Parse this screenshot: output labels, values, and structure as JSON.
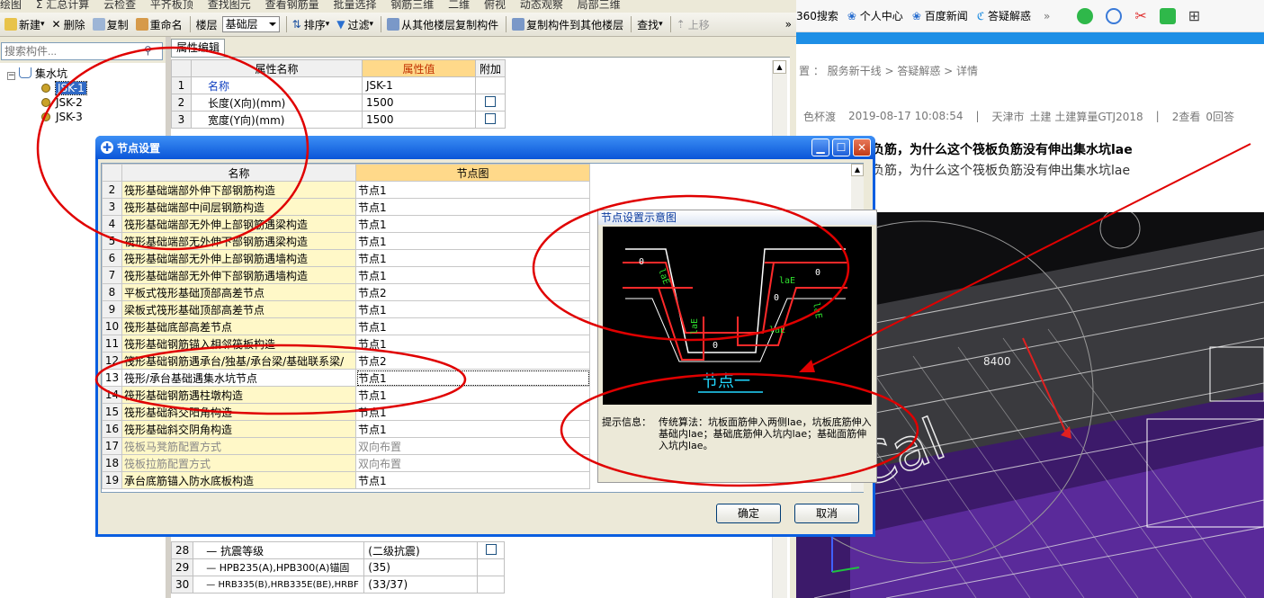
{
  "toolbar_top": {
    "items": [
      "绘图",
      "Σ 汇总计算",
      "云检查",
      "平齐板顶",
      "查找图元",
      "查看钢筋量",
      "批量选择",
      "钢筋三维",
      "二维",
      "俯视",
      "动态观察",
      "局部三维"
    ]
  },
  "toolbar": {
    "new_label": "新建",
    "delete_label": "删除",
    "copy_label": "复制",
    "rename_label": "重命名",
    "floor_label": "楼层",
    "floor_value": "基础层",
    "sort_label": "排序",
    "filter_label": "过滤",
    "copy_from_floor": "从其他楼层复制构件",
    "copy_to_floor": "复制构件到其他楼层",
    "find_label": "查找",
    "up_label": "上移",
    "more": "»"
  },
  "search": {
    "placeholder": "搜索构件..."
  },
  "tree": {
    "root": "集水坑",
    "items": [
      "JSK-1",
      "JSK-2",
      "JSK-3"
    ]
  },
  "props": {
    "tab": "属性编辑",
    "headers": [
      "属性名称",
      "属性值",
      "附加"
    ],
    "rows_top": [
      {
        "num": "1",
        "name": "名称",
        "value": "JSK-1",
        "check": false
      },
      {
        "num": "2",
        "name": "长度(X向)(mm)",
        "value": "1500",
        "check": true
      },
      {
        "num": "3",
        "name": "宽度(Y向)(mm)",
        "value": "1500",
        "check": true
      }
    ],
    "rows_bottom": [
      {
        "num": "28",
        "name": "— 抗震等级",
        "value": "(二级抗震)",
        "check": true
      },
      {
        "num": "29",
        "name": "— HPB235(A),HPB300(A)锚固",
        "value": "(35)",
        "check": false
      },
      {
        "num": "30",
        "name": "— HRB335(B),HRB335E(BE),HRBF",
        "value": "(33/37)",
        "check": false
      }
    ]
  },
  "dialog": {
    "title": "节点设置",
    "headers": [
      "名称",
      "节点图"
    ],
    "rows": [
      {
        "num": "2",
        "name": "筏形基础端部外伸下部钢筋构造",
        "value": "节点1",
        "grey": false
      },
      {
        "num": "3",
        "name": "筏形基础端部中间层钢筋构造",
        "value": "节点1",
        "grey": false
      },
      {
        "num": "4",
        "name": "筏形基础端部无外伸上部钢筋遇梁构造",
        "value": "节点1",
        "grey": false
      },
      {
        "num": "5",
        "name": "筏形基础端部无外伸下部钢筋遇梁构造",
        "value": "节点1",
        "grey": false
      },
      {
        "num": "6",
        "name": "筏形基础端部无外伸上部钢筋遇墙构造",
        "value": "节点1",
        "grey": false
      },
      {
        "num": "7",
        "name": "筏形基础端部无外伸下部钢筋遇墙构造",
        "value": "节点1",
        "grey": false
      },
      {
        "num": "8",
        "name": "平板式筏形基础顶部高差节点",
        "value": "节点2",
        "grey": false
      },
      {
        "num": "9",
        "name": "梁板式筏形基础顶部高差节点",
        "value": "节点1",
        "grey": false
      },
      {
        "num": "10",
        "name": "筏形基础底部高差节点",
        "value": "节点1",
        "grey": false
      },
      {
        "num": "11",
        "name": "筏形基础钢筋锚入相邻筏板构造",
        "value": "节点1",
        "grey": false
      },
      {
        "num": "12",
        "name": "筏形基础钢筋遇承台/独基/承台梁/基础联系梁/",
        "value": "节点2",
        "grey": false
      },
      {
        "num": "13",
        "name": "筏形/承台基础遇集水坑节点",
        "value": "节点1",
        "grey": false,
        "selected": true
      },
      {
        "num": "14",
        "name": "筏形基础钢筋遇柱墩构造",
        "value": "节点1",
        "grey": false
      },
      {
        "num": "15",
        "name": "筏形基础斜交阳角构造",
        "value": "节点1",
        "grey": false
      },
      {
        "num": "16",
        "name": "筏形基础斜交阴角构造",
        "value": "节点1",
        "grey": false
      },
      {
        "num": "17",
        "name": "筏板马凳筋配置方式",
        "value": "双向布置",
        "grey": true
      },
      {
        "num": "18",
        "name": "筏板拉筋配置方式",
        "value": "双向布置",
        "grey": true
      },
      {
        "num": "19",
        "name": "承台底筋锚入防水底板构造",
        "value": "节点1",
        "grey": false
      }
    ],
    "preview": {
      "title": "节点设置示意图",
      "labels": [
        "laE",
        "laE",
        "laE",
        "laE",
        "laE",
        "0",
        "0",
        "0",
        "0"
      ],
      "caption": "节点一",
      "hint_label": "提示信息：",
      "hint_text": "传统算法：坑板面筋伸入两侧lae，坑板底筋伸入基础内lae；基础底筋伸入坑内lae；基础面筋伸入坑内lae。"
    },
    "ok": "确定",
    "cancel": "取消"
  },
  "browser": {
    "toolbar": [
      "360搜索",
      "个人中心",
      "百度新闻",
      "答疑解惑",
      "»"
    ],
    "breadcrumb": "置 ： 服务新干线 > 答疑解惑 > 详情",
    "meta": {
      "user": "色杯渡",
      "time": "2019-08-17 10:08:54",
      "region": "天津市",
      "category": "土建 土建算量GTJ2018",
      "views": "2查看",
      "answers": "0回答"
    },
    "title": "指向的是筏板负筋，为什么这个筏板负筋没有伸出集水坑lae",
    "body": "指向的是筏板负筋，为什么这个筏板负筋没有伸出集水坑lae",
    "scene_label": "8400"
  },
  "colors": {
    "accent": "#0a5ee0",
    "highlight": "#fff8c8",
    "annotation": "#e00000",
    "rebar": "#ff2020"
  }
}
